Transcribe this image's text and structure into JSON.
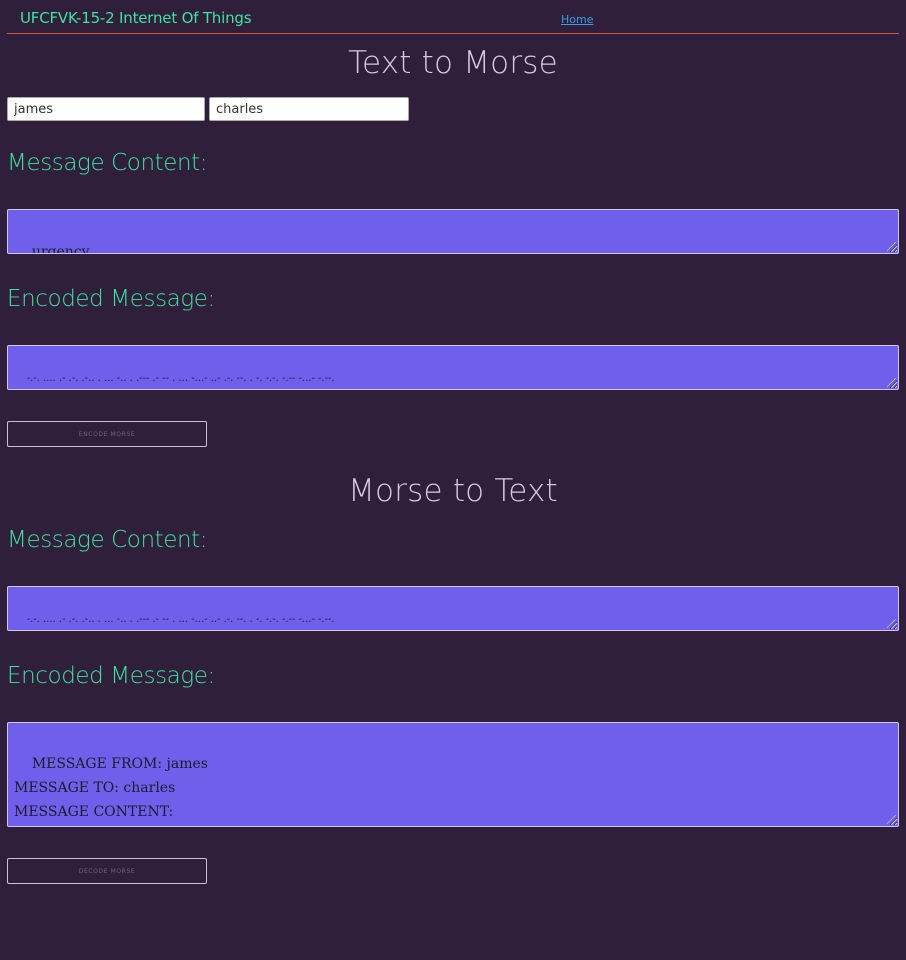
{
  "header": {
    "brand": "UFCFVK-15-2 Internet Of Things",
    "nav_home": "Home"
  },
  "encode": {
    "title": "Text to Morse",
    "from_value": "james",
    "to_value": "charles",
    "content_label": "Message Content:",
    "content_value": "urgency",
    "encoded_label": "Encoded Message:",
    "encoded_value": "-.-. .... .- .-. .-.. . ... -.. . .--- .- -- . ... -...- ..- .-. --. . -. -.-. -.-- -...- -.--.",
    "button": "ENCODE MORSE"
  },
  "decode": {
    "title": "Morse to Text",
    "content_label": "Message Content:",
    "content_value": "-.-. .... .- .-. .-.. . ... -.. . .--- .- -- . ... -...- ..- .-. --. . -. -.-. -.-- -...- -.--.",
    "decoded_label": "Encoded Message:",
    "decoded_value": "MESSAGE FROM: james\nMESSAGE TO: charles\nMESSAGE CONTENT:\nurgency",
    "button": "DECODE MORSE"
  },
  "colors": {
    "background": "#2f1f3a",
    "accent_green": "#3ee3a0",
    "textarea_bg": "#6f5fea",
    "divider": "#d9533a",
    "link": "#3a9ee6"
  }
}
